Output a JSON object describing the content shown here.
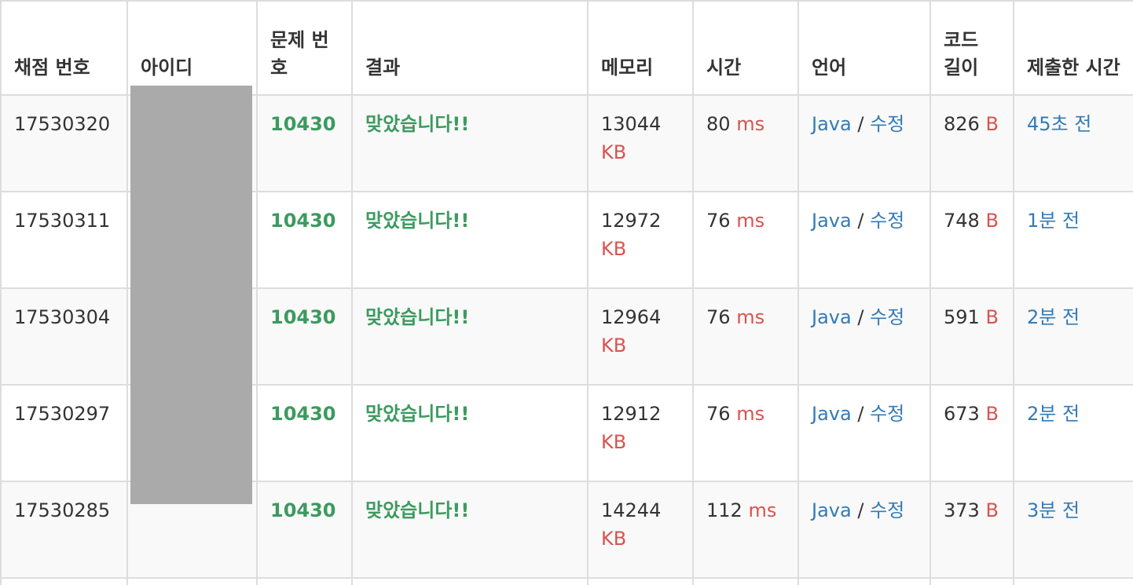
{
  "headers": {
    "submission_id": "채점 번호",
    "user_id": "아이디",
    "problem": "문제 번호",
    "result": "결과",
    "memory": "메모리",
    "time": "시간",
    "language": "언어",
    "code_length": "코드 길이",
    "submitted_at": "제출한 시간"
  },
  "units": {
    "memory": "KB",
    "time": "ms",
    "length": "B"
  },
  "language_edit_separator": "/",
  "rows": [
    {
      "id": "17530320",
      "problem": "10430",
      "result": "맞았습니다!!",
      "memory": "13044",
      "time": "80",
      "lang": "Java",
      "edit": "수정",
      "length": "826",
      "submitted": "45초 전"
    },
    {
      "id": "17530311",
      "problem": "10430",
      "result": "맞았습니다!!",
      "memory": "12972",
      "time": "76",
      "lang": "Java",
      "edit": "수정",
      "length": "748",
      "submitted": "1분 전"
    },
    {
      "id": "17530304",
      "problem": "10430",
      "result": "맞았습니다!!",
      "memory": "12964",
      "time": "76",
      "lang": "Java",
      "edit": "수정",
      "length": "591",
      "submitted": "2분 전"
    },
    {
      "id": "17530297",
      "problem": "10430",
      "result": "맞았습니다!!",
      "memory": "12912",
      "time": "76",
      "lang": "Java",
      "edit": "수정",
      "length": "673",
      "submitted": "2분 전"
    },
    {
      "id": "17530285",
      "problem": "10430",
      "result": "맞았습니다!!",
      "memory": "14244",
      "time": "112",
      "lang": "Java",
      "edit": "수정",
      "length": "373",
      "submitted": "3분 전"
    }
  ]
}
